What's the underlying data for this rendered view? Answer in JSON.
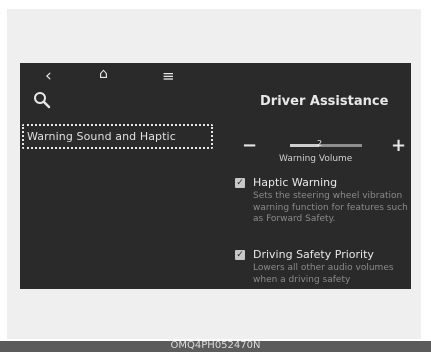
{
  "topbar": {
    "back_icon": "‹",
    "home_icon": "⌂",
    "menu_icon": "≡"
  },
  "search": {
    "icon": "search-icon",
    "current_text": "Warning Sound and Haptic"
  },
  "panel": {
    "title": "Driver Assistance",
    "volume": {
      "minus_label": "−",
      "plus_label": "+",
      "value": "2",
      "level_fraction": 0.4,
      "label": "Warning Volume"
    },
    "options": [
      {
        "checked": true,
        "title": "Haptic Warning",
        "description": "Sets the steering wheel vibration warning function for features such as Forward Safety."
      },
      {
        "checked": true,
        "title": "Driving Safety Priority",
        "description": "Lowers all other audio volumes when a driving safety"
      }
    ]
  },
  "footer": {
    "code": "OMQ4PH052470N"
  }
}
